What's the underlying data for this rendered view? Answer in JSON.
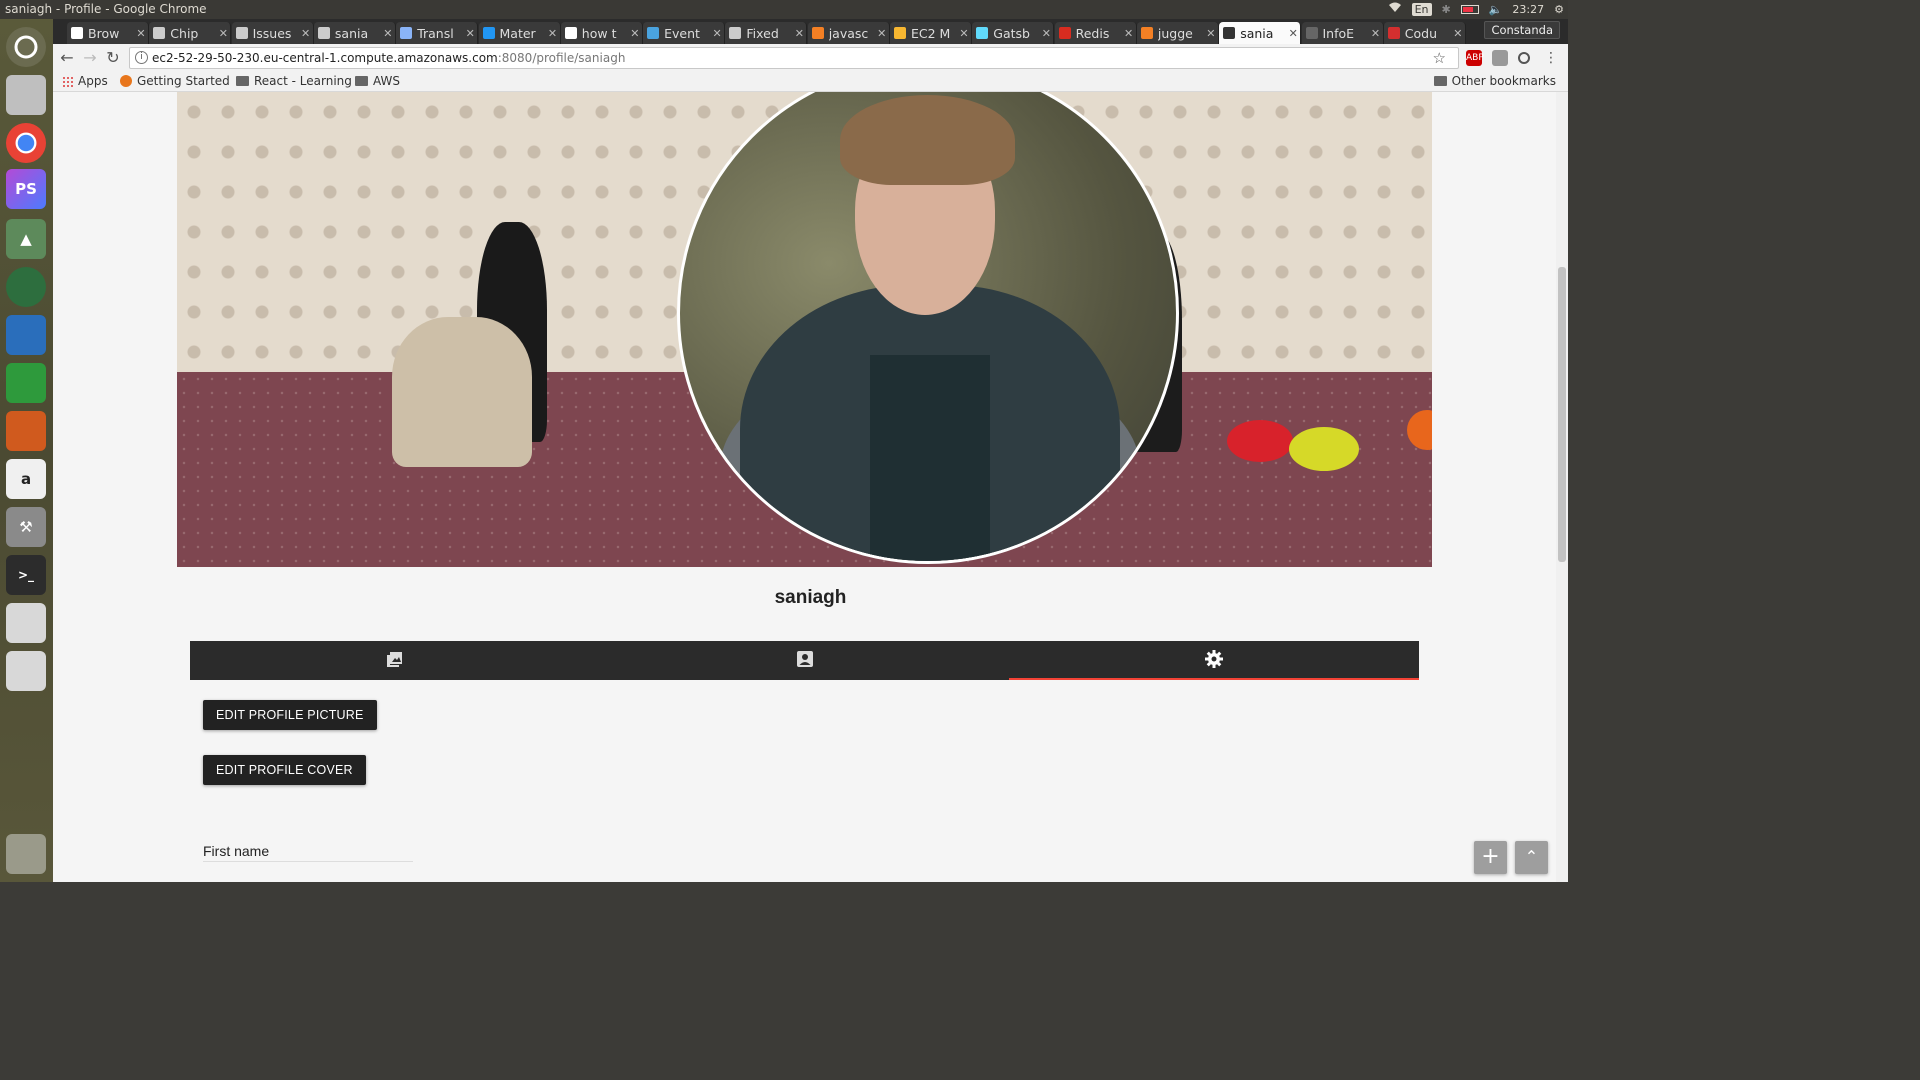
{
  "os": {
    "window_title": "saniagh - Profile - Google Chrome",
    "input_lang": "En",
    "clock": "23:27"
  },
  "browser": {
    "profile_name": "Constanda",
    "tabs": [
      {
        "label": "Brow",
        "favicon": "square-4-icon",
        "color": "#ffffff"
      },
      {
        "label": "Chip",
        "favicon": "chip-icon",
        "color": "#cccccc"
      },
      {
        "label": "Issues",
        "favicon": "github-icon",
        "color": "#cccccc"
      },
      {
        "label": "sania",
        "favicon": "github-icon",
        "color": "#cccccc"
      },
      {
        "label": "Transl",
        "favicon": "doc-icon",
        "color": "#8ab4f8"
      },
      {
        "label": "Mater",
        "favicon": "circle-icon",
        "color": "#2196f3"
      },
      {
        "label": "how t",
        "favicon": "google-icon",
        "color": "#ffffff"
      },
      {
        "label": "Event",
        "favicon": "cloud-icon",
        "color": "#4aa3df"
      },
      {
        "label": "Fixed",
        "favicon": "github-icon",
        "color": "#cccccc"
      },
      {
        "label": "javasc",
        "favicon": "stackoverflow-icon",
        "color": "#f48024"
      },
      {
        "label": "EC2 M",
        "favicon": "aws-box-icon",
        "color": "#f7b731"
      },
      {
        "label": "Gatsb",
        "favicon": "react-icon",
        "color": "#61dafb"
      },
      {
        "label": "Redis",
        "favicon": "redis-icon",
        "color": "#d82c20"
      },
      {
        "label": "jugge",
        "favicon": "stackoverflow-icon",
        "color": "#f48024"
      },
      {
        "label": "sania",
        "favicon": "square-4-icon",
        "color": "#333333",
        "active": true
      },
      {
        "label": "InfoE",
        "favicon": "page-icon",
        "color": "#666666"
      },
      {
        "label": "Codu",
        "favicon": "shield-icon",
        "color": "#d32f2f"
      }
    ],
    "url_host": "ec2-52-29-50-230.eu-central-1.compute.amazonaws.com",
    "url_path": ":8080/profile/saniagh",
    "bookmarks": [
      {
        "label": "Apps",
        "icon": "apps-grid-icon"
      },
      {
        "label": "Getting Started",
        "icon": "firefox-icon"
      },
      {
        "label": "React - Learning",
        "icon": "folder-icon"
      },
      {
        "label": "AWS",
        "icon": "folder-icon"
      }
    ],
    "other_bookmarks": "Other bookmarks"
  },
  "profile": {
    "username": "saniagh",
    "tabs": [
      {
        "name": "gallery",
        "icon": "photo-library-icon"
      },
      {
        "name": "info",
        "icon": "account-box-icon"
      },
      {
        "name": "settings",
        "icon": "gear-icon",
        "active": true
      }
    ],
    "edit_picture_label": "EDIT PROFILE PICTURE",
    "edit_cover_label": "EDIT PROFILE COVER",
    "first_name_label": "First name"
  },
  "colors": {
    "accent": "#f44336",
    "tabs_bg": "#2b2b2b"
  }
}
